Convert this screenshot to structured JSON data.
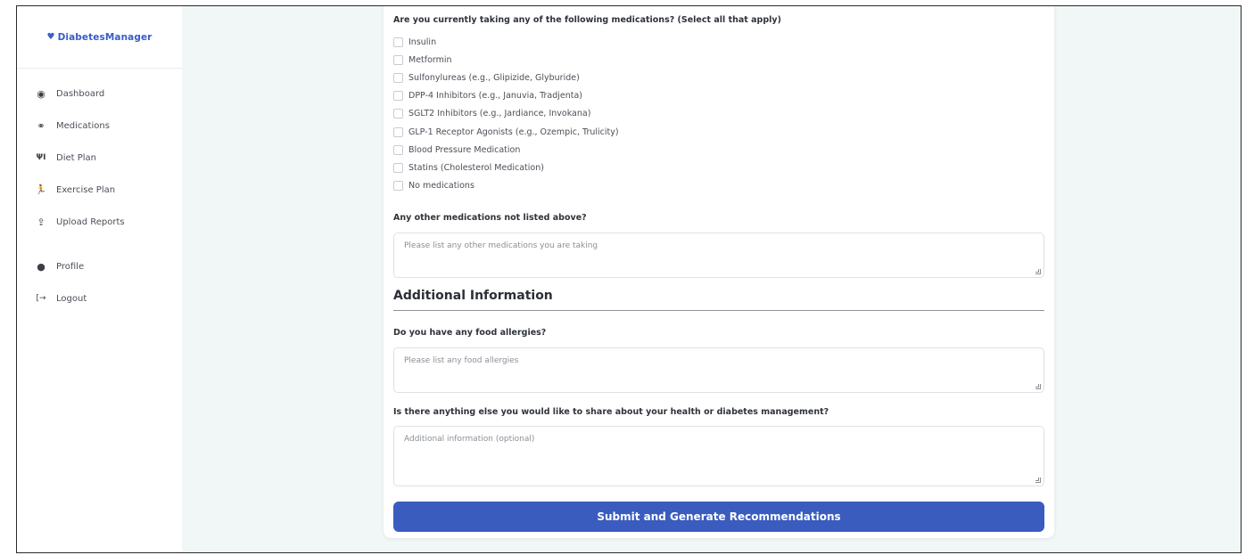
{
  "sidebar": {
    "brand": {
      "icon": "heart-icon",
      "icon_glyph": "♥",
      "label": "DiabetesManager"
    },
    "items": [
      {
        "icon": "dashboard-icon",
        "glyph": "◉",
        "label": "Dashboard"
      },
      {
        "icon": "pills-icon",
        "glyph": "⚭",
        "label": "Medications"
      },
      {
        "icon": "utensils-icon",
        "glyph": "ΨΙ",
        "label": "Diet Plan"
      },
      {
        "icon": "running-icon",
        "glyph": "🏃",
        "label": "Exercise Plan"
      },
      {
        "icon": "upload-icon",
        "glyph": "⇪",
        "label": "Upload Reports"
      },
      {
        "icon": "user-circle-icon",
        "glyph": "●",
        "label": "Profile"
      },
      {
        "icon": "logout-icon",
        "glyph": "[→",
        "label": "Logout"
      }
    ]
  },
  "form": {
    "medications_question": "Are you currently taking any of the following medications? (Select all that apply)",
    "medications": [
      "Insulin",
      "Metformin",
      "Sulfonylureas (e.g., Glipizide, Glyburide)",
      "DPP-4 Inhibitors (e.g., Januvia, Tradjenta)",
      "SGLT2 Inhibitors (e.g., Jardiance, Invokana)",
      "GLP-1 Receptor Agonists (e.g., Ozempic, Trulicity)",
      "Blood Pressure Medication",
      "Statins (Cholesterol Medication)",
      "No medications"
    ],
    "other_meds_label": "Any other medications not listed above?",
    "other_meds_placeholder": "Please list any other medications you are taking",
    "section_title": "Additional Information",
    "allergies_label": "Do you have any food allergies?",
    "allergies_placeholder": "Please list any food allergies",
    "additional_label": "Is there anything else you would like to share about your health or diabetes management?",
    "additional_placeholder": "Additional information (optional)",
    "submit_label": "Submit and Generate Recommendations"
  },
  "colors": {
    "brand": "#3a5cc8",
    "primary_button": "#3a5cbf",
    "page_background": "#f1f7f6"
  }
}
